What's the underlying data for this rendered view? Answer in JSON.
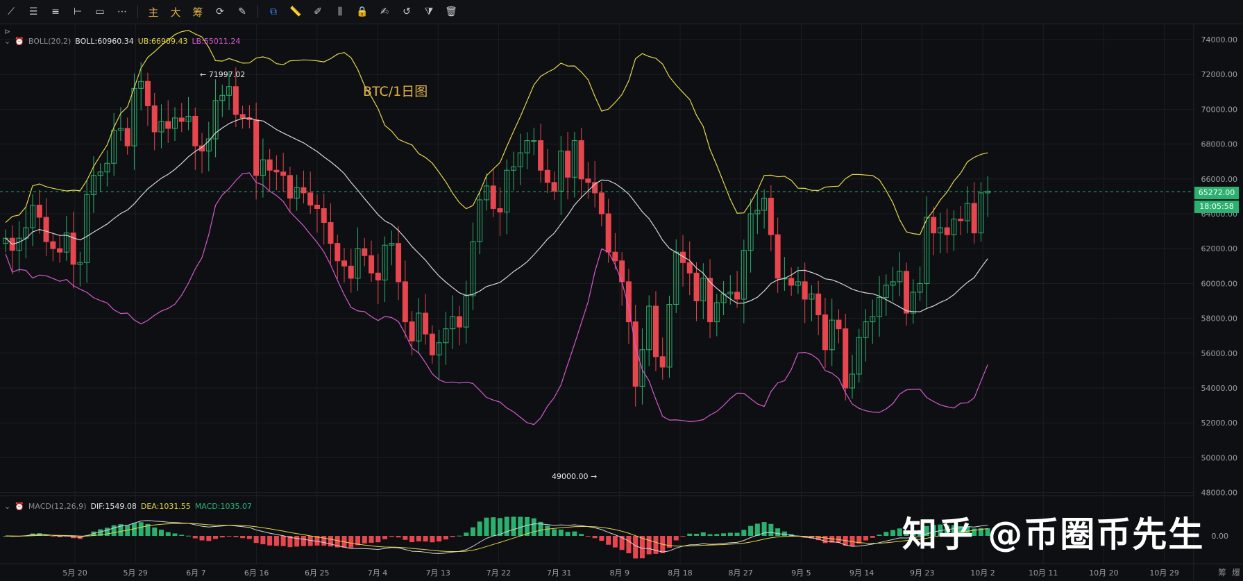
{
  "toolbar": {
    "tools": [
      {
        "icon": "line-icon",
        "glyph": "⟋"
      },
      {
        "icon": "hlines-icon",
        "glyph": "☰"
      },
      {
        "icon": "parallel-icon",
        "glyph": "≡"
      },
      {
        "icon": "crosshair-line-icon",
        "glyph": "⊢"
      },
      {
        "icon": "rectangle-icon",
        "glyph": "▭"
      },
      {
        "icon": "more-icon",
        "glyph": "⋯"
      }
    ],
    "words": [
      "主",
      "大",
      "筹"
    ],
    "tools2": [
      {
        "icon": "refresh-icon",
        "glyph": "⟳"
      },
      {
        "icon": "eraser-icon",
        "glyph": "✎"
      },
      {
        "icon": "magnet-icon",
        "glyph": "⧉",
        "active": true
      },
      {
        "icon": "ruler-icon",
        "glyph": "📏"
      },
      {
        "icon": "brush-icon",
        "glyph": "✐"
      },
      {
        "icon": "candle-icon",
        "glyph": "⫼"
      },
      {
        "icon": "lock-icon",
        "glyph": "🔒"
      },
      {
        "icon": "note-icon",
        "glyph": "✍"
      },
      {
        "icon": "undo-icon",
        "glyph": "↺"
      },
      {
        "icon": "filter-icon",
        "glyph": "⧩"
      },
      {
        "icon": "trash-icon",
        "glyph": "🗑"
      }
    ]
  },
  "boll_legend": {
    "name": "BOLL(20,2)",
    "boll": "BOLL:60960.34",
    "ub": "UB:66909.43",
    "lb": "LB:55011.24"
  },
  "macd_legend": {
    "name": "MACD(12,26,9)",
    "dif": "DIF:1549.08",
    "dea": "DEA:1031.55",
    "macd": "MACD:1035.07"
  },
  "chart_title": "BTC/1日图",
  "last_price": "65272.00",
  "countdown": "18:05:58",
  "high_annot": "← 71997.02",
  "low_annot": "49000.00 →",
  "watermark": "知乎 @币圈币先生",
  "bottom_right": [
    "筹",
    "爆"
  ],
  "colors": {
    "up": "#2ab06f",
    "down": "#e8464f",
    "mid": "#d8d8d8",
    "ub": "#e6d84d",
    "lb": "#d65bd0",
    "grid": "#1c1e23"
  },
  "chart_data": {
    "type": "candlestick",
    "title": "BTC/1日图",
    "ylim": [
      47000,
      75000
    ],
    "yticks": [
      48000,
      50000,
      52000,
      54000,
      56000,
      58000,
      60000,
      62000,
      64000,
      66000,
      68000,
      70000,
      72000,
      74000
    ],
    "ytick_labels": [
      "48000.00",
      "50000.00",
      "52000.00",
      "54000.00",
      "56000.00",
      "58000.00",
      "60000.00",
      "62000.00",
      "64000.00",
      "66000.00",
      "68000.00",
      "70000.00",
      "72000.00",
      "74000.00"
    ],
    "xtick_labels": [
      "5月 20",
      "5月 29",
      "6月 7",
      "6月 16",
      "6月 25",
      "7月 4",
      "7月 13",
      "7月 22",
      "7月 31",
      "8月 9",
      "8月 18",
      "8月 27",
      "9月 5",
      "9月 14",
      "9月 23",
      "10月 2",
      "10月 11",
      "10月 20",
      "10月 29"
    ],
    "macd_ytick": "0.00",
    "day_count_per_tick": 9,
    "closes": [
      62600,
      61900,
      62600,
      63200,
      64500,
      63800,
      62400,
      62000,
      61800,
      62900,
      61100,
      61200,
      65100,
      66200,
      66400,
      66900,
      68800,
      68900,
      67900,
      71200,
      71600,
      70200,
      68700,
      69300,
      68900,
      69500,
      69300,
      69600,
      67900,
      67600,
      68300,
      70500,
      70800,
      71300,
      69700,
      69500,
      69400,
      66200,
      67100,
      66500,
      66400,
      66200,
      64900,
      65500,
      65200,
      64500,
      64300,
      63500,
      62300,
      61300,
      61000,
      60300,
      62000,
      61600,
      60600,
      60200,
      62200,
      62300,
      60100,
      57800,
      56700,
      58300,
      57100,
      55900,
      56600,
      57400,
      58100,
      57500,
      59300,
      62400,
      64800,
      65600,
      64300,
      64100,
      66500,
      66700,
      67500,
      68200,
      68200,
      66500,
      65800,
      65300,
      67600,
      66100,
      68200,
      66000,
      65800,
      65200,
      64000,
      61800,
      61300,
      60100,
      57800,
      54100,
      56200,
      58700,
      55800,
      55200,
      58800,
      61800,
      61200,
      60600,
      59000,
      60300,
      57800,
      58900,
      59400,
      59500,
      59100,
      61900,
      64000,
      64200,
      64900,
      62800,
      60300,
      60300,
      59900,
      60100,
      59100,
      59400,
      58200,
      56200,
      57900,
      57400,
      54000,
      54800,
      56900,
      57800,
      58100,
      59200,
      59900,
      60100,
      60700,
      58300,
      59500,
      60000,
      63800,
      62900,
      63200,
      62800,
      63700,
      63600,
      64600,
      62900,
      65200,
      65300
    ]
  }
}
